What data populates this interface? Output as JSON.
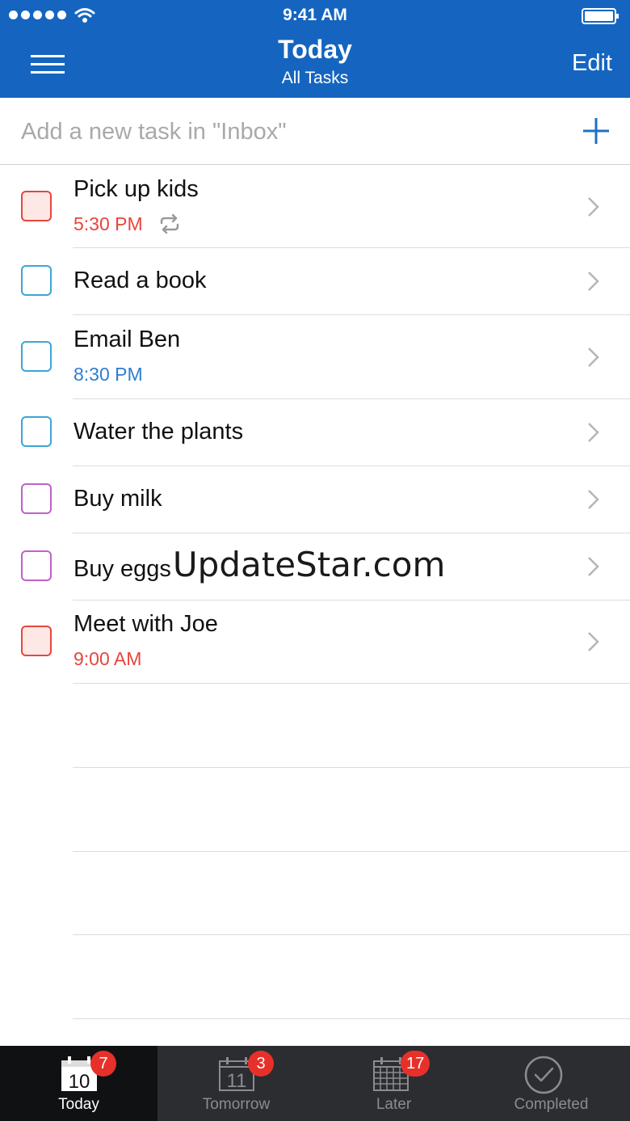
{
  "status_bar": {
    "time": "9:41 AM"
  },
  "header": {
    "title": "Today",
    "subtitle": "All Tasks",
    "edit_label": "Edit"
  },
  "add_task": {
    "placeholder": "Add a new task in \"Inbox\""
  },
  "tasks": [
    {
      "title": "Pick up kids",
      "time": "5:30 PM",
      "time_color": "#e8453c",
      "checkbox_color": "#e8453c",
      "checkbox_fill": "#fde8e6",
      "repeat": true
    },
    {
      "title": "Read a book",
      "checkbox_color": "#3aa6d6",
      "checkbox_fill": "#ffffff"
    },
    {
      "title": "Email Ben",
      "time": "8:30 PM",
      "time_color": "#2f7dd1",
      "checkbox_color": "#3aa6d6",
      "checkbox_fill": "#ffffff"
    },
    {
      "title": "Water the plants",
      "checkbox_color": "#3aa6d6",
      "checkbox_fill": "#ffffff"
    },
    {
      "title": "Buy milk",
      "checkbox_color": "#c062c8",
      "checkbox_fill": "#ffffff"
    },
    {
      "title": "Buy eggs",
      "watermark": "UpdateStar.com",
      "checkbox_color": "#c062c8",
      "checkbox_fill": "#ffffff"
    },
    {
      "title": "Meet with Joe",
      "time": "9:00 AM",
      "time_color": "#e8453c",
      "checkbox_color": "#e8453c",
      "checkbox_fill": "#fde8e6"
    }
  ],
  "tabs": [
    {
      "label": "Today",
      "icon": "calendar-today-icon",
      "icon_text": "10",
      "badge": "7",
      "active": true
    },
    {
      "label": "Tomorrow",
      "icon": "calendar-tomorrow-icon",
      "icon_text": "11",
      "badge": "3",
      "active": false
    },
    {
      "label": "Later",
      "icon": "calendar-grid-icon",
      "badge": "17",
      "active": false
    },
    {
      "label": "Completed",
      "icon": "checkmark-circle-icon",
      "active": false
    }
  ],
  "colors": {
    "header_blue": "#1565c0",
    "badge_red": "#e8302a",
    "tabbar_bg": "#2b2d31"
  }
}
